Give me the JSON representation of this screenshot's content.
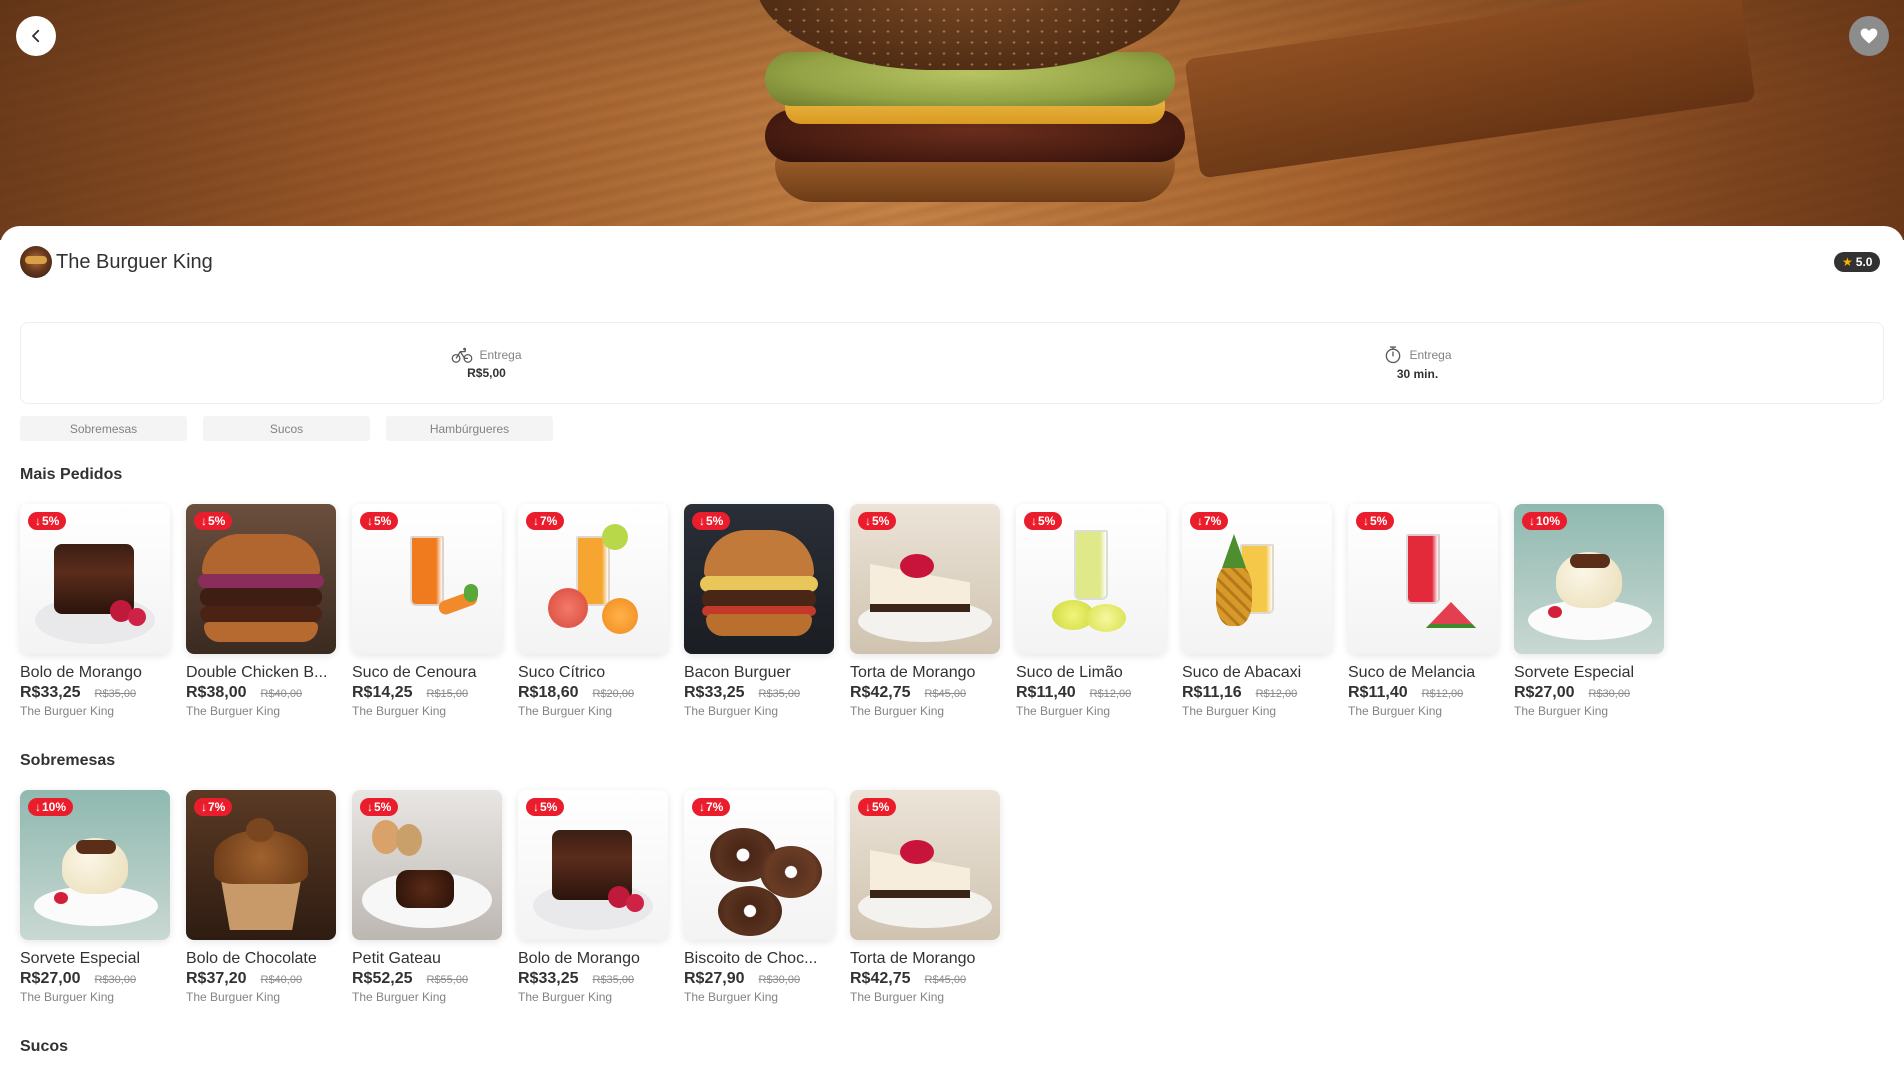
{
  "hero": {
    "back_icon": "chevron-left-icon",
    "favorite_icon": "heart-icon"
  },
  "restaurant": {
    "name": "The Burguer King",
    "rating": "5.0"
  },
  "info": {
    "delivery_fee": {
      "label": "Entrega",
      "value": "R$5,00",
      "icon": "bicycle-icon"
    },
    "delivery_time": {
      "label": "Entrega",
      "value": "30 min.",
      "icon": "timer-icon"
    }
  },
  "categories": [
    "Sobremesas",
    "Sucos",
    "Hambúrgueres"
  ],
  "sections": [
    {
      "title": "Mais Pedidos",
      "products": [
        {
          "name": "Bolo de Morango",
          "price": "R$33,25",
          "old_price": "R$35,00",
          "discount": "5%",
          "restaurant": "The Burguer King",
          "image": "chocolate-strawberry-cake"
        },
        {
          "name": "Double Chicken B...",
          "price": "R$38,00",
          "old_price": "R$40,00",
          "discount": "5%",
          "restaurant": "The Burguer King",
          "image": "double-burger"
        },
        {
          "name": "Suco de Cenoura",
          "price": "R$14,25",
          "old_price": "R$15,00",
          "discount": "5%",
          "restaurant": "The Burguer King",
          "image": "carrot-juice"
        },
        {
          "name": "Suco Cítrico",
          "price": "R$18,60",
          "old_price": "R$20,00",
          "discount": "7%",
          "restaurant": "The Burguer King",
          "image": "citrus-juice"
        },
        {
          "name": "Bacon Burguer",
          "price": "R$33,25",
          "old_price": "R$35,00",
          "discount": "5%",
          "restaurant": "The Burguer King",
          "image": "bacon-burger"
        },
        {
          "name": "Torta de Morango",
          "price": "R$42,75",
          "old_price": "R$45,00",
          "discount": "5%",
          "restaurant": "The Burguer King",
          "image": "strawberry-cheesecake"
        },
        {
          "name": "Suco de Limão",
          "price": "R$11,40",
          "old_price": "R$12,00",
          "discount": "5%",
          "restaurant": "The Burguer King",
          "image": "lemon-juice"
        },
        {
          "name": "Suco de Abacaxi",
          "price": "R$11,16",
          "old_price": "R$12,00",
          "discount": "7%",
          "restaurant": "The Burguer King",
          "image": "pineapple-juice"
        },
        {
          "name": "Suco de Melancia",
          "price": "R$11,40",
          "old_price": "R$12,00",
          "discount": "5%",
          "restaurant": "The Burguer King",
          "image": "watermelon-juice"
        },
        {
          "name": "Sorvete Especial",
          "price": "R$27,00",
          "old_price": "R$30,00",
          "discount": "10%",
          "restaurant": "The Burguer King",
          "image": "ice-cream"
        }
      ]
    },
    {
      "title": "Sobremesas",
      "products": [
        {
          "name": "Sorvete Especial",
          "price": "R$27,00",
          "old_price": "R$30,00",
          "discount": "10%",
          "restaurant": "The Burguer King",
          "image": "ice-cream"
        },
        {
          "name": "Bolo de Chocolate",
          "price": "R$37,20",
          "old_price": "R$40,00",
          "discount": "7%",
          "restaurant": "The Burguer King",
          "image": "chocolate-cupcake"
        },
        {
          "name": "Petit Gateau",
          "price": "R$52,25",
          "old_price": "R$55,00",
          "discount": "5%",
          "restaurant": "The Burguer King",
          "image": "petit-gateau"
        },
        {
          "name": "Bolo de Morango",
          "price": "R$33,25",
          "old_price": "R$35,00",
          "discount": "5%",
          "restaurant": "The Burguer King",
          "image": "chocolate-strawberry-cake"
        },
        {
          "name": "Biscoito de Choc...",
          "price": "R$27,90",
          "old_price": "R$30,00",
          "discount": "7%",
          "restaurant": "The Burguer King",
          "image": "chocolate-donuts"
        },
        {
          "name": "Torta de Morango",
          "price": "R$42,75",
          "old_price": "R$45,00",
          "discount": "5%",
          "restaurant": "The Burguer King",
          "image": "strawberry-cheesecake"
        }
      ]
    },
    {
      "title": "Sucos",
      "products": []
    }
  ],
  "colors": {
    "accent_red": "#EA1D2C",
    "text_dark": "#323232",
    "text_gray": "#838383",
    "rating_star": "#FFB100"
  }
}
